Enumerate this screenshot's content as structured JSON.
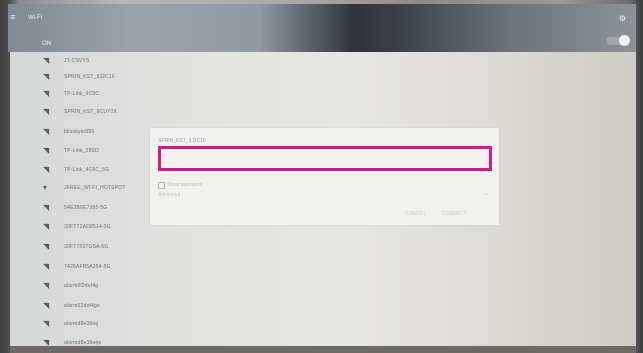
{
  "topbar": {
    "menu_icon": "≡",
    "title": "Wi-Fi",
    "on_label": "ON",
    "gear_icon": "⚙"
  },
  "networks": [
    {
      "name": "JT-CSVYS",
      "icon": "wifi-lock-icon"
    },
    {
      "name": "SPRIN_KST_9J2C1F",
      "icon": "wifi-lock-icon"
    },
    {
      "name": "TP-Link_4C6C",
      "icon": "wifi-lock-icon"
    },
    {
      "name": "SPRIN_KST_9CUY2X",
      "icon": "wifi-lock-icon"
    },
    {
      "name": "blissbyte999",
      "icon": "wifi-lock-icon"
    },
    {
      "name": "TP-Link_2B5D",
      "icon": "wifi-lock-icon"
    },
    {
      "name": "TP-Link_4C6C_5G",
      "icon": "wifi-lock-icon"
    },
    {
      "name": "JFREE_WI-FI_HOTSPOT",
      "icon": "wifi-icon"
    },
    {
      "name": "54E3B6E7355-5G",
      "icon": "wifi-lock-icon"
    },
    {
      "name": "30FTT2AD8514-5G",
      "icon": "wifi-lock-icon"
    },
    {
      "name": "30FT7597GSA-5G",
      "icon": "wifi-lock-icon"
    },
    {
      "name": "7425AFB5A354-5G",
      "icon": "wifi-lock-icon"
    },
    {
      "name": "alarm0l2def4g",
      "icon": "wifi-lock-icon"
    },
    {
      "name": "alarm02def4ge",
      "icon": "wifi-lock-icon"
    },
    {
      "name": "alarmd8e38eg",
      "icon": "wifi-lock-icon"
    },
    {
      "name": "alarmd8e38eqe",
      "icon": "wifi-lock-icon"
    }
  ],
  "dialog": {
    "title": "SPRIN_KST_9J2C1F",
    "password_value": "",
    "show_password_label": "Show password",
    "advanced_label": "Advanced",
    "cancel_label": "CANCEL",
    "connect_label": "CONNECT"
  },
  "colors": {
    "highlight": "#d11a8f"
  }
}
